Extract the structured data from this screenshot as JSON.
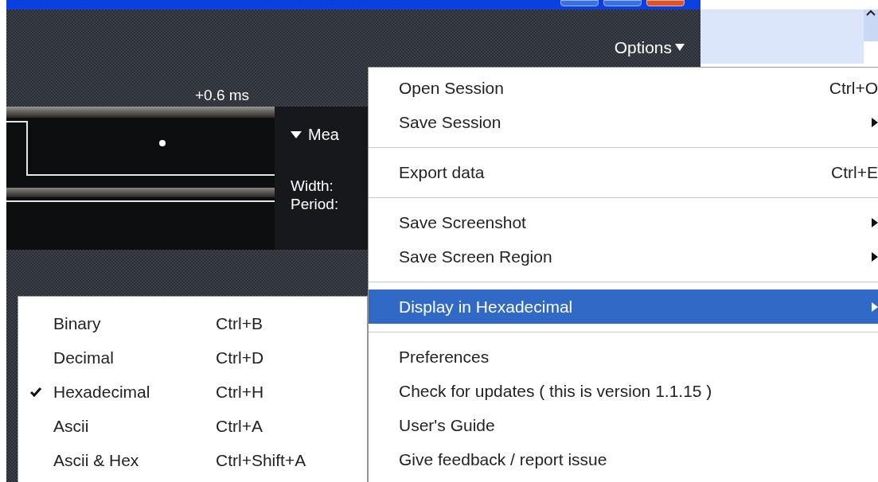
{
  "toolbar": {
    "options_button": "Options"
  },
  "waveform": {
    "time_marker": "+0.6 ms"
  },
  "measurements": {
    "header": "Mea",
    "expanded": true,
    "labels": [
      "Width:",
      "Period:"
    ]
  },
  "options_menu": [
    {
      "kind": "item",
      "label": "Open Session",
      "shortcut": "Ctrl+O",
      "submenu": false,
      "selected": false
    },
    {
      "kind": "item",
      "label": "Save Session",
      "submenu": true,
      "selected": false
    },
    {
      "kind": "separator"
    },
    {
      "kind": "item",
      "label": "Export data",
      "shortcut": "Ctrl+E",
      "submenu": false,
      "selected": false
    },
    {
      "kind": "separator"
    },
    {
      "kind": "item",
      "label": "Save Screenshot",
      "submenu": true,
      "selected": false
    },
    {
      "kind": "item",
      "label": "Save Screen Region",
      "submenu": true,
      "selected": false
    },
    {
      "kind": "separator"
    },
    {
      "kind": "item",
      "label": "Display in Hexadecimal",
      "submenu": true,
      "selected": true
    },
    {
      "kind": "separator"
    },
    {
      "kind": "item",
      "label": "Preferences",
      "submenu": false,
      "selected": false
    },
    {
      "kind": "item",
      "label": "Check for updates ( this is version 1.1.15 )",
      "submenu": false,
      "selected": false
    },
    {
      "kind": "item",
      "label": "User's Guide",
      "submenu": false,
      "selected": false
    },
    {
      "kind": "item",
      "label": "Give feedback / report issue",
      "submenu": false,
      "selected": false
    }
  ],
  "display_submenu": [
    {
      "label": "Binary",
      "shortcut": "Ctrl+B",
      "checked": false
    },
    {
      "label": "Decimal",
      "shortcut": "Ctrl+D",
      "checked": false
    },
    {
      "label": "Hexadecimal",
      "shortcut": "Ctrl+H",
      "checked": true
    },
    {
      "label": "Ascii",
      "shortcut": "Ctrl+A",
      "checked": false
    },
    {
      "label": "Ascii & Hex",
      "shortcut": "Ctrl+Shift+A",
      "checked": false
    }
  ]
}
